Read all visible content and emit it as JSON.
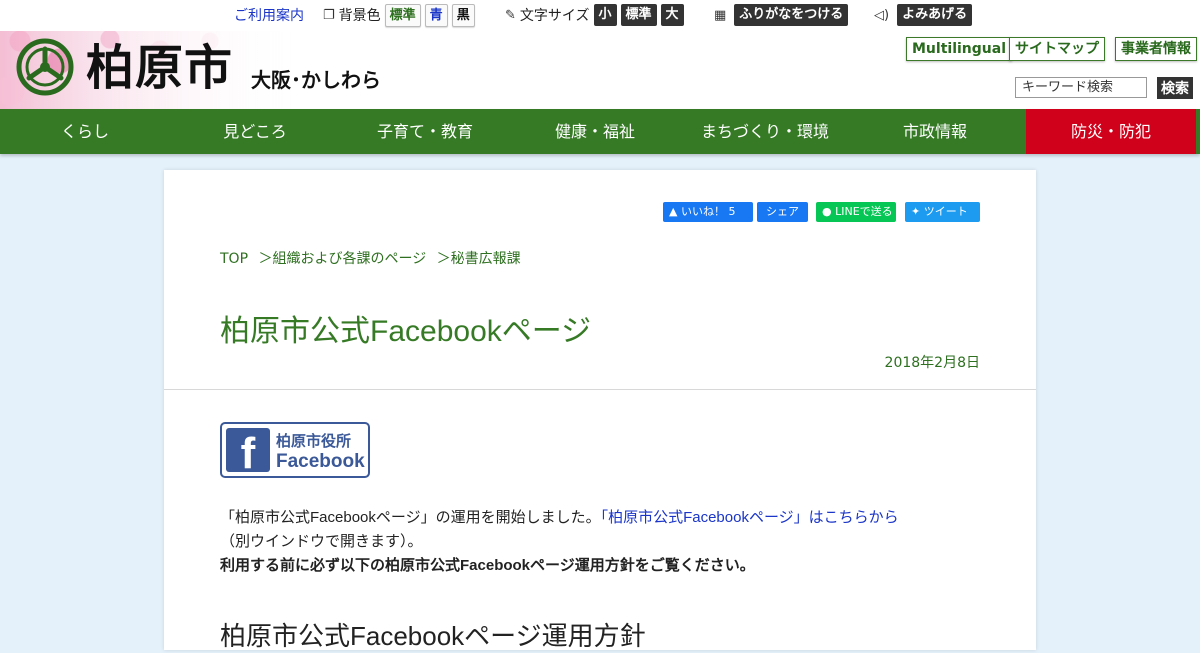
{
  "util_bar": {
    "guide_link": "ご利用案内",
    "bg_label": "背景色",
    "bg_options": [
      "標準",
      "青",
      "黒"
    ],
    "font_label": "文字サイズ",
    "font_options": [
      "小",
      "標準",
      "大"
    ],
    "furigana_button": "ふりがなをつける",
    "readaloud_button": "よみあげる"
  },
  "header": {
    "city_name": "柏原市",
    "city_sub": "大阪･かしわら",
    "buttons": [
      "Multilingual",
      "サイトマップ",
      "事業者情報"
    ],
    "search_placeholder": "キーワード検索",
    "search_button": "検索"
  },
  "nav": {
    "items": [
      "くらし",
      "見どころ",
      "子育て・教育",
      "健康・福祉",
      "まちづくり・環境",
      "市政情報",
      "防災・防犯"
    ]
  },
  "share": {
    "like": "いいね！ 5",
    "share": "シェア",
    "line": "LINEで送る",
    "tweet": "ツイート"
  },
  "breadcrumb": [
    "TOP",
    "＞組織および各課のページ",
    "＞秘書広報課"
  ],
  "page": {
    "title": "柏原市公式Facebookページ",
    "date": "2018年2月8日",
    "banner_line1": "柏原市役所",
    "banner_line2": "Facebook",
    "text_before_link": "「柏原市公式Facebookページ」の運用を開始しました。",
    "link_text": "「柏原市公式Facebookページ」はこちらから",
    "text_after_link": "（別ウインドウで開きます）。",
    "bold_notice": "利用する前に必ず以下の柏原市公式Facebookページ運用方針をご覧ください。",
    "sub_heading": "柏原市公式Facebookページ運用方針"
  },
  "colors": {
    "green": "#367a26",
    "disaster_red": "#d0021b",
    "background": "#e4f0fa",
    "link_blue": "#1a35c8"
  }
}
